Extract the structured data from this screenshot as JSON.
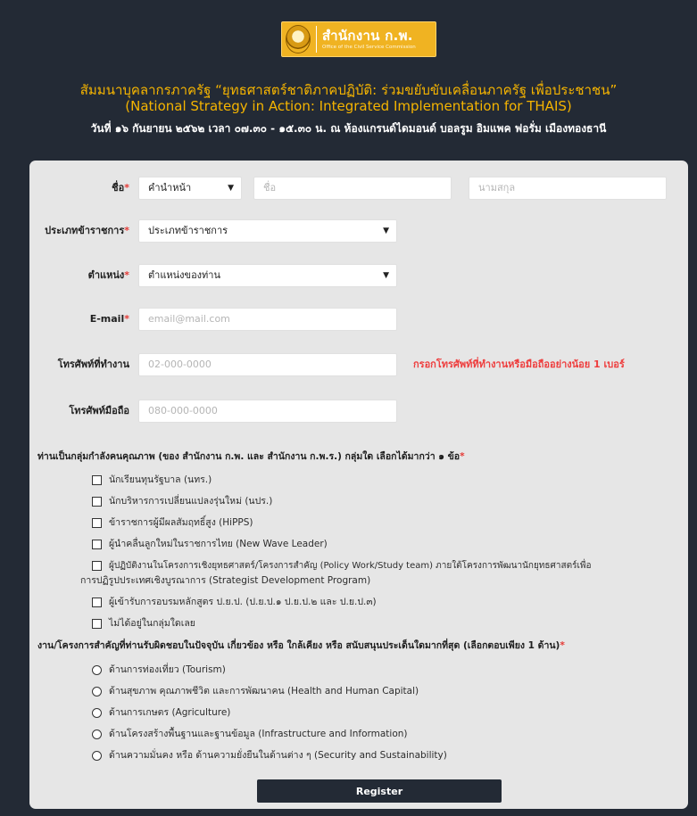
{
  "header": {
    "logo_text": "สำนักงาน ก.พ.",
    "logo_subtext": "Office of the Civil Service Commission",
    "title_th": "สัมมนาบุคลากรภาครัฐ “ยุทธศาสตร์ชาติภาคปฏิบัติ: ร่วมขยับขับเคลื่อนภาครัฐ เพื่อประชาชน”",
    "title_en": "(National Strategy in Action: Integrated Implementation for THAIS)",
    "subtitle": "วันที่ ๑๖ กันยายน ๒๕๖๒ เวลา ๐๗.๓๐ - ๑๕.๓๐ น. ณ ห้องแกรนด์ไดมอนด์ บอลรูม อิมแพค ฟอรั่ม เมืองทองธานี"
  },
  "form": {
    "required_mark": "*",
    "name_label": "ชื่อ",
    "prefix_select": "คำนำหน้า",
    "firstname_placeholder": "ชื่อ",
    "lastname_placeholder": "นามสกุล",
    "official_type_label": "ประเภทข้าราชการ",
    "official_type_select": "ประเภทข้าราชการ",
    "position_label": "ตำแหน่ง",
    "position_select": "ตำแหน่งของท่าน",
    "email_label": "E-mail",
    "email_placeholder": "email@mail.com",
    "office_phone_label": "โทรศัพท์ที่ทำงาน",
    "office_phone_placeholder": "02-000-0000",
    "phone_warning": "กรอกโทรศัพท์ที่ทำงานหรือมือถืออย่างน้อย 1 เบอร์",
    "mobile_label": "โทรศัพท์มือถือ",
    "mobile_placeholder": "080-000-0000",
    "caret": "▼",
    "group_question": "ท่านเป็นกลุ่มกำลังคนคุณภาพ (ของ สำนักงาน ก.พ. และ สำนักงาน ก.พ.ร.) กลุ่มใด เลือกได้มากว่า ๑ ข้อ",
    "group_options": [
      "นักเรียนทุนรัฐบาล (นทร.)",
      "นักบริหารการเปลี่ยนแปลงรุ่นใหม่ (นปร.)",
      "ข้าราชการผู้มีผลสัมฤทธิ์สูง (HiPPS)",
      "ผู้นำคลื่นลูกใหม่ในราชการไทย (New Wave Leader)",
      "ผู้ปฏิบัติงานในโครงการเชิงยุทธศาสตร์/โครงการสำคัญ (Policy Work/Study team) ภายใต้โครงการพัฒนานักยุทธศาสตร์เพื่อ",
      "ผู้เข้ารับการอบรมหลักสูตร ป.ย.ป. (ป.ย.ป.๑ ป.ย.ป.๒ และ ป.ย.ป.๓)",
      "ไม่ได้อยู่ในกลุ่มใดเลย"
    ],
    "group_option_4_cont": "การปฏิรูปประเทศเชิงบูรณาการ (Strategist Development Program)",
    "work_question": "งาน/โครงการสำคัญที่ท่านรับผิดชอบในปัจจุบัน เกี่ยวข้อง หรือ ใกล้เคียง หรือ สนับสนุนประเด็นใดมากที่สุด (เลือกตอบเพียง 1 ด้าน)",
    "work_options": [
      "ด้านการท่องเที่ยว (Tourism)",
      "ด้านสุขภาพ คุณภาพชีวิต และการพัฒนาคน (Health and Human Capital)",
      "ด้านการเกษตร (Agriculture)",
      "ด้านโครงสร้างพื้นฐานและฐานข้อมูล (Infrastructure and Information)",
      "ด้านความมั่นคง หรือ ด้านความยั่งยืนในด้านต่าง ๆ (Security and Sustainability)"
    ],
    "register_label": "Register"
  },
  "colors": {
    "background": "#232a35",
    "accent": "#f5b400",
    "panel": "#e6e6e6",
    "required": "#e53935"
  }
}
